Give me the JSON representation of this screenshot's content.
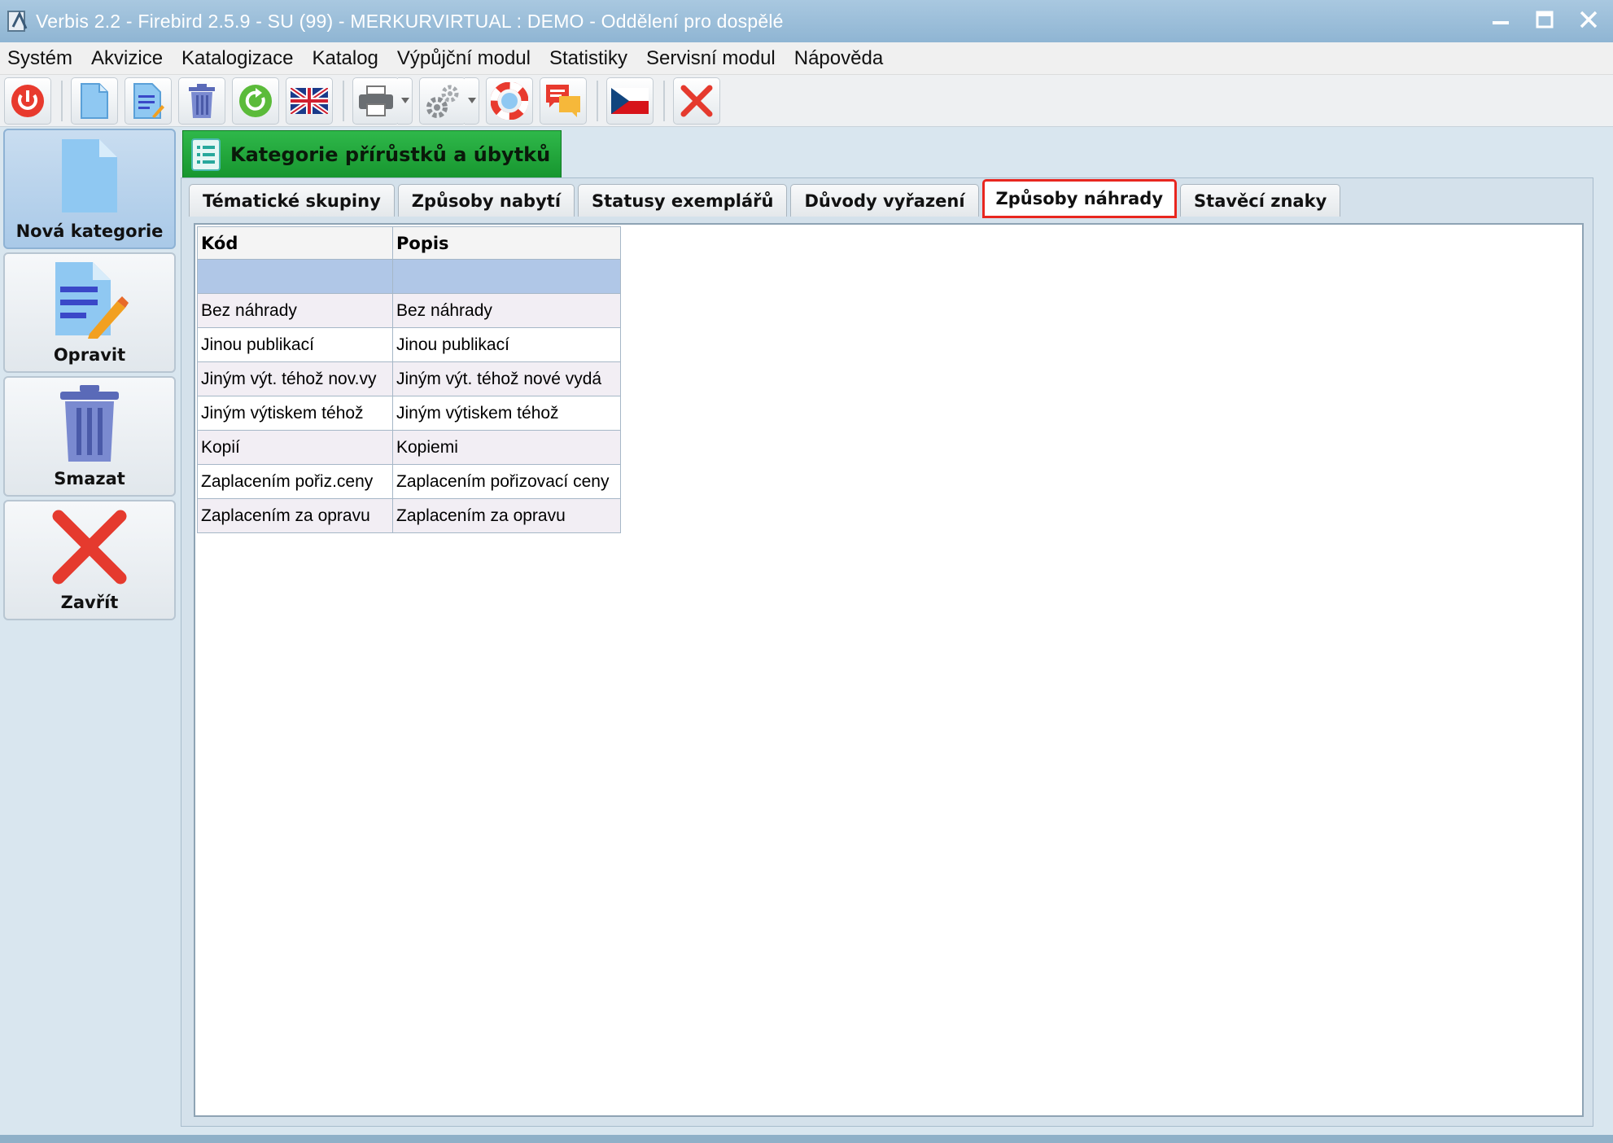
{
  "window": {
    "title": "Verbis 2.2 - Firebird 2.5.9 - SU (99) - MERKURVIRTUAL : DEMO - Oddělení pro dospělé"
  },
  "menu": [
    "Systém",
    "Akvizice",
    "Katalogizace",
    "Katalog",
    "Výpůjční modul",
    "Statistiky",
    "Servisní modul",
    "Nápověda"
  ],
  "toolbar": {
    "icons": [
      "power-icon",
      "new-document-icon",
      "edit-document-icon",
      "trash-icon",
      "refresh-icon",
      "uk-flag-icon",
      "printer-icon",
      "settings-gear-icon",
      "help-lifebuoy-icon",
      "chat-icon",
      "czech-flag-icon",
      "close-icon"
    ]
  },
  "sidebar": {
    "new": "Nová kategorie",
    "edit": "Opravit",
    "delete": "Smazat",
    "close": "Zavřít"
  },
  "panel": {
    "title": "Kategorie přírůstků a úbytků"
  },
  "tabs": [
    "Tématické skupiny",
    "Způsoby nabytí",
    "Statusy exemplářů",
    "Důvody vyřazení",
    "Způsoby náhrady",
    "Stavěcí znaky"
  ],
  "active_tab": "Způsoby náhrady",
  "table": {
    "headers": [
      "Kód",
      "Popis"
    ],
    "rows": [
      [
        "",
        ""
      ],
      [
        "Bez náhrady",
        "Bez náhrady"
      ],
      [
        "Jinou publikací",
        "Jinou publikací"
      ],
      [
        "Jiným výt. téhož nov.vy",
        "Jiným výt. téhož nové vydá"
      ],
      [
        "Jiným výtiskem téhož",
        "Jiným výtiskem téhož"
      ],
      [
        "Kopií",
        "Kopiemi"
      ],
      [
        "Zaplacením pořiz.ceny",
        "Zaplacením pořizovací ceny"
      ],
      [
        "Zaplacením za opravu",
        "Zaplacením za opravu"
      ]
    ]
  },
  "colors": {
    "header_green": "#1fa73a",
    "active_tab_border": "#e8261f",
    "selected_row": "#b0c7e7"
  }
}
